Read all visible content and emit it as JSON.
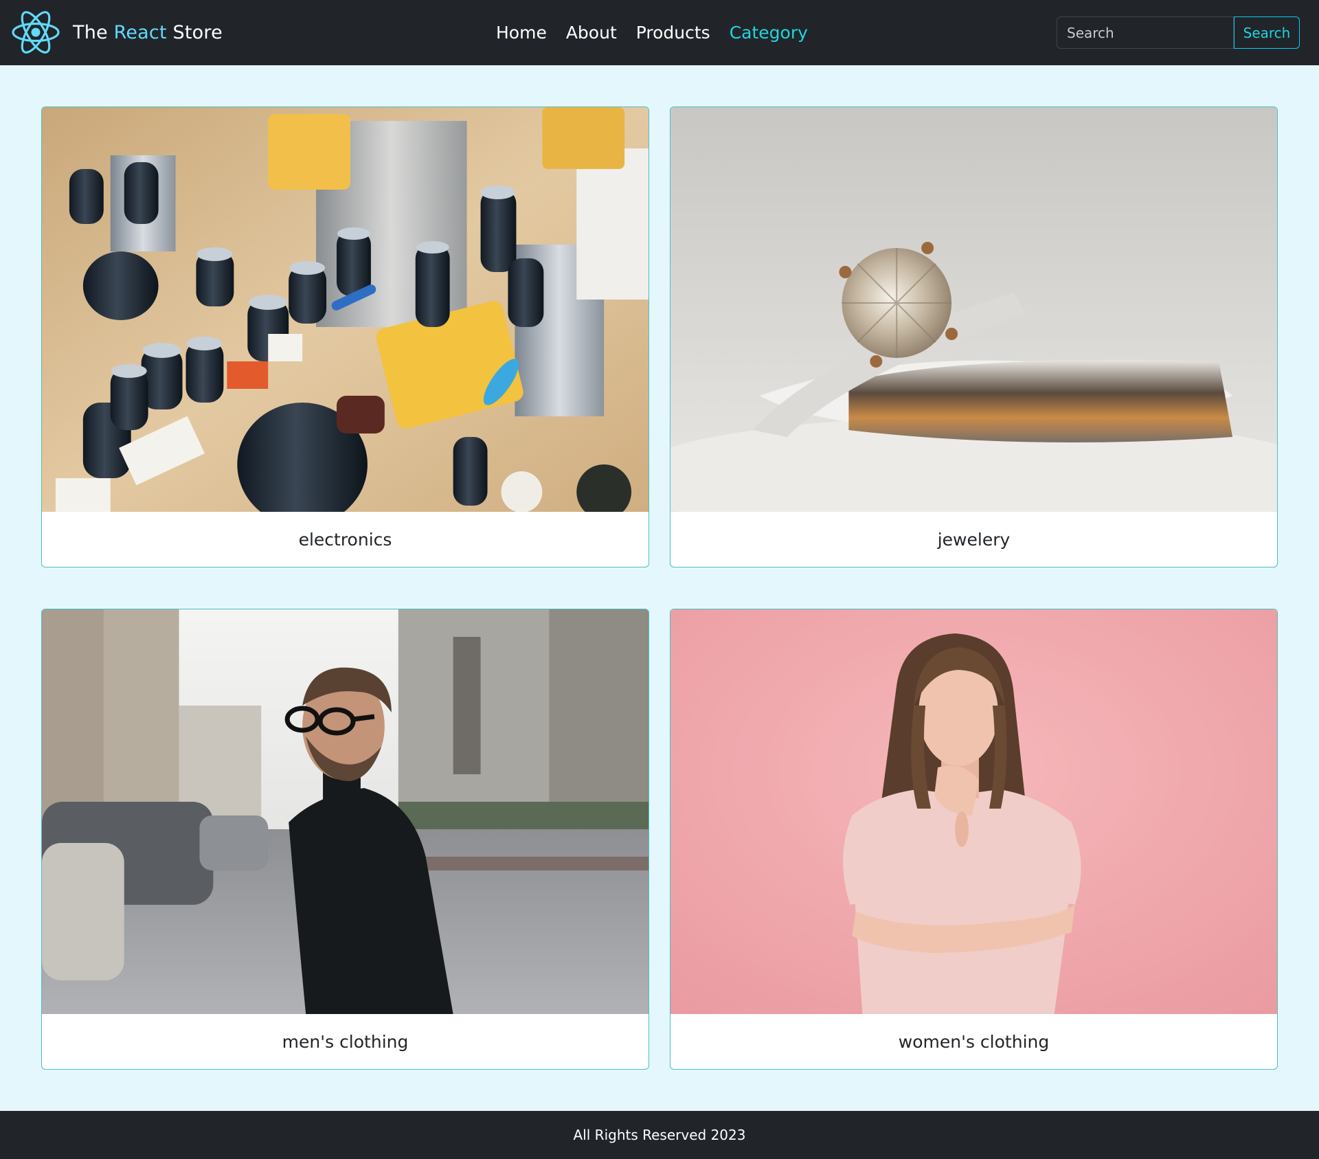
{
  "brand": {
    "prefix": "The ",
    "accent": "React",
    "suffix": " Store",
    "logo_icon": "react-atom-icon",
    "accent_color": "#61dafb"
  },
  "nav": {
    "items": [
      {
        "label": "Home",
        "active": false
      },
      {
        "label": "About",
        "active": false
      },
      {
        "label": "Products",
        "active": false
      },
      {
        "label": "Category",
        "active": true
      }
    ]
  },
  "search": {
    "placeholder": "Search",
    "value": "",
    "button_label": "Search"
  },
  "categories": [
    {
      "title": "electronics",
      "image": "circuit-board-photo"
    },
    {
      "title": "jewelery",
      "image": "diamond-ring-photo"
    },
    {
      "title": "men's clothing",
      "image": "man-in-black-turtleneck-photo"
    },
    {
      "title": "women's clothing",
      "image": "woman-in-pink-dress-photo"
    }
  ],
  "footer": {
    "text": "All Rights Reserved 2023"
  },
  "colors": {
    "navbar_bg": "#212529",
    "page_bg": "#e4f7fc",
    "active_link": "#22d3e0",
    "card_border": "#4fbfbf"
  }
}
